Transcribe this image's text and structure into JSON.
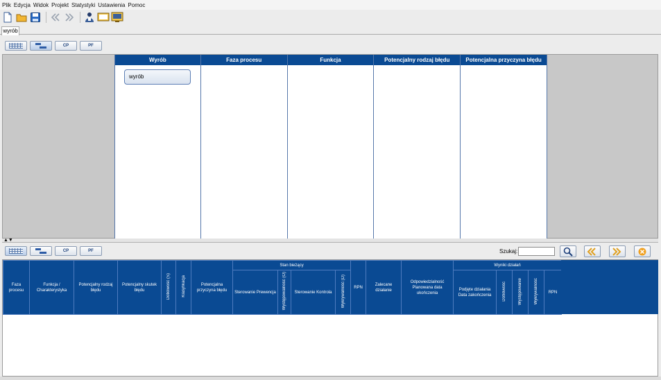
{
  "menu": [
    "Plik",
    "Edycja",
    "Widok",
    "Projekt",
    "Statystyki",
    "Ustawienia",
    "Pomoc"
  ],
  "tab": {
    "label": "wyrób"
  },
  "view_buttons": {
    "cp": "CP",
    "pf": "PF"
  },
  "columns": [
    "Wyrób",
    "Faza procesu",
    "Funkcja",
    "Potencjalny rodzaj błędu",
    "Potencjalna przyczyna błędu"
  ],
  "tree_node": {
    "label": "wyrób"
  },
  "search": {
    "label": "Szukaj:",
    "value": ""
  },
  "table": {
    "faza": "Faza procesu",
    "funkcja": "Funkcja / Charakterystyka",
    "rodzaj": "Potencjalny rodzaj błędu",
    "skutek": "Potencjalny skutek błędu",
    "dotkliwosc": "Dotkliwość (S)",
    "klasyfikacja": "Klasyfikacja",
    "przyczyna": "Potencjalna przyczyna błędu",
    "stan": "Stan bieżący",
    "prewencja": "Sterowanie Prewencja",
    "wystepowalnosc": "Występowalność (O)",
    "kontrola": "Sterowanie Kontrola",
    "wykrywalnosc": "Wykrywalność (D)",
    "rpn": "RPN",
    "zalecane": "Zalecane działanie",
    "odpowiedzialnosc": "Odpowiedzialność Planowana data ukończenia",
    "wyniki": "Wyniki działań",
    "podjete": "Podjęte działania Data zakończenia",
    "w_dotkliwosc": "Dotkliwość",
    "w_wystepowanie": "Występowanie",
    "w_wykrywalnosc": "Wykrywalność",
    "w_rpn": "RPN"
  },
  "colors": {
    "header": "#0a4a93",
    "border": "#5577aa"
  }
}
